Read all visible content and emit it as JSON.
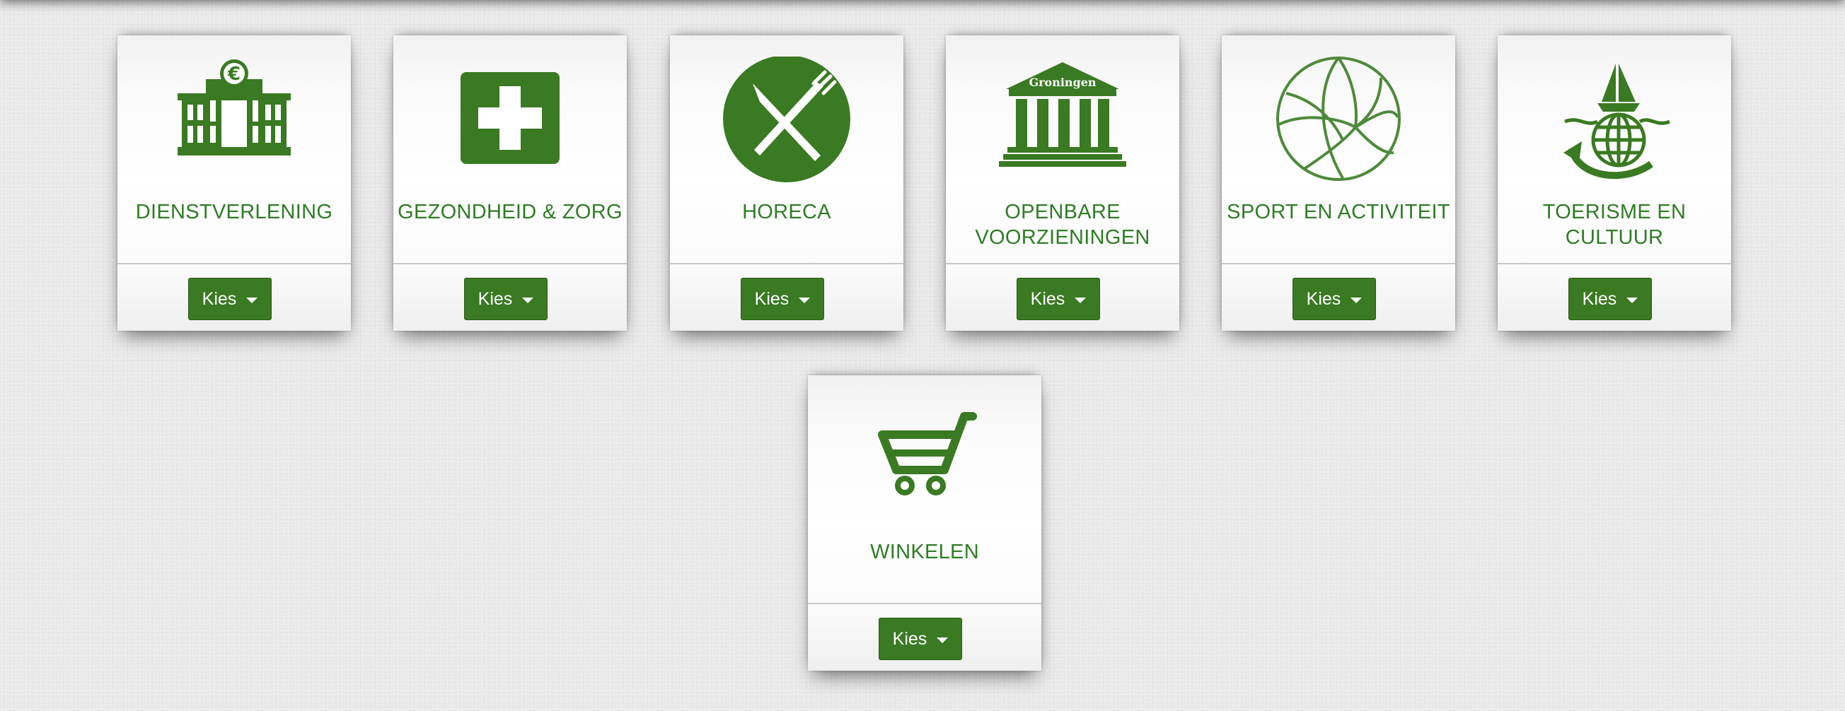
{
  "colors": {
    "brand_green": "#2e7d24",
    "button_green": "#3a7a22",
    "background": "#e9e9e9"
  },
  "categories": [
    {
      "title": "DIENSTVERLENING",
      "icon": "building-euro-icon",
      "button_label": "Kies"
    },
    {
      "title": "GEZONDHEID & ZORG",
      "icon": "medical-cross-icon",
      "button_label": "Kies"
    },
    {
      "title": "HORECA",
      "icon": "knife-fork-icon",
      "button_label": "Kies"
    },
    {
      "title": "OPENBARE VOORZIENINGEN",
      "icon": "public-building-icon",
      "icon_text": "Groningen",
      "button_label": "Kies"
    },
    {
      "title": "SPORT EN ACTIVITEIT",
      "icon": "volleyball-icon",
      "button_label": "Kies"
    },
    {
      "title": "TOERISME EN CULTUUR",
      "icon": "globe-boat-icon",
      "button_label": "Kies"
    },
    {
      "title": "WINKELEN",
      "icon": "shopping-cart-icon",
      "button_label": "Kies"
    }
  ]
}
